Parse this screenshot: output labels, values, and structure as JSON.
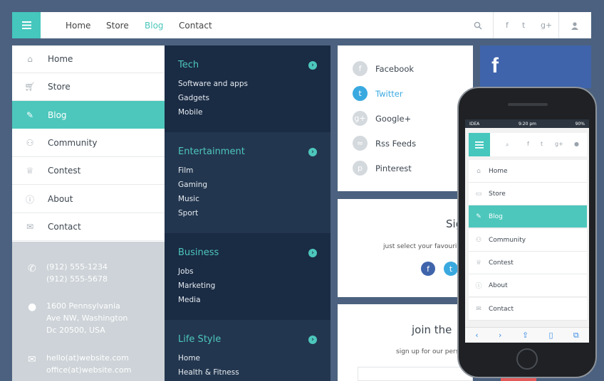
{
  "topnav": {
    "items": [
      "Home",
      "Store",
      "Blog",
      "Contact"
    ],
    "active": "Blog",
    "social": [
      "f",
      "t",
      "g+"
    ]
  },
  "sidemenu": {
    "items": [
      {
        "label": "Home",
        "icon": "home-icon"
      },
      {
        "label": "Store",
        "icon": "cart-icon"
      },
      {
        "label": "Blog",
        "icon": "edit-icon",
        "active": true
      },
      {
        "label": "Community",
        "icon": "people-icon"
      },
      {
        "label": "Contest",
        "icon": "trophy-icon"
      },
      {
        "label": "About",
        "icon": "info-icon"
      },
      {
        "label": "Contact",
        "icon": "mail-icon"
      }
    ]
  },
  "contact": {
    "phone1": "(912) 555-1234",
    "phone2": "(912) 555-5678",
    "addr1": "1600 Pennsylvania",
    "addr2": "Ave NW, Washington",
    "addr3": "Dc 20500, USA",
    "email1": "hello(at)website.com",
    "email2": "office(at)website.com"
  },
  "categories": [
    {
      "title": "Tech",
      "items": [
        "Software and apps",
        "Gadgets",
        "Mobile"
      ]
    },
    {
      "title": "Entertainment",
      "items": [
        "Film",
        "Gaming",
        "Music",
        "Sport"
      ]
    },
    {
      "title": "Business",
      "items": [
        "Jobs",
        "Marketing",
        "Media"
      ]
    },
    {
      "title": "Life Style",
      "items": [
        "Home",
        "Health & Fitness"
      ]
    }
  ],
  "social_list": [
    {
      "label": "Facebook",
      "glyph": "f"
    },
    {
      "label": "Twitter",
      "glyph": "t",
      "active": true
    },
    {
      "label": "Google+",
      "glyph": "g+"
    },
    {
      "label": "Rss Feeds",
      "glyph": "≈"
    },
    {
      "label": "Pinterest",
      "glyph": "p"
    }
  ],
  "signup": {
    "title_partial": "Sig",
    "subtitle_partial": "just select your favourite",
    "join_title": "join the",
    "join_sub": "sign up for our perso"
  },
  "phone": {
    "carrier": "IDEA",
    "time": "9:20 pm",
    "battery": "90%",
    "menu": [
      "Home",
      "Store",
      "Blog",
      "Community",
      "Contest",
      "About",
      "Contact"
    ],
    "active": "Blog"
  },
  "colors": {
    "accent": "#4dc7bc",
    "dark": "#1a2b44",
    "darker": "#23364f",
    "facebook": "#3f64ab",
    "bg": "#4b617f"
  }
}
